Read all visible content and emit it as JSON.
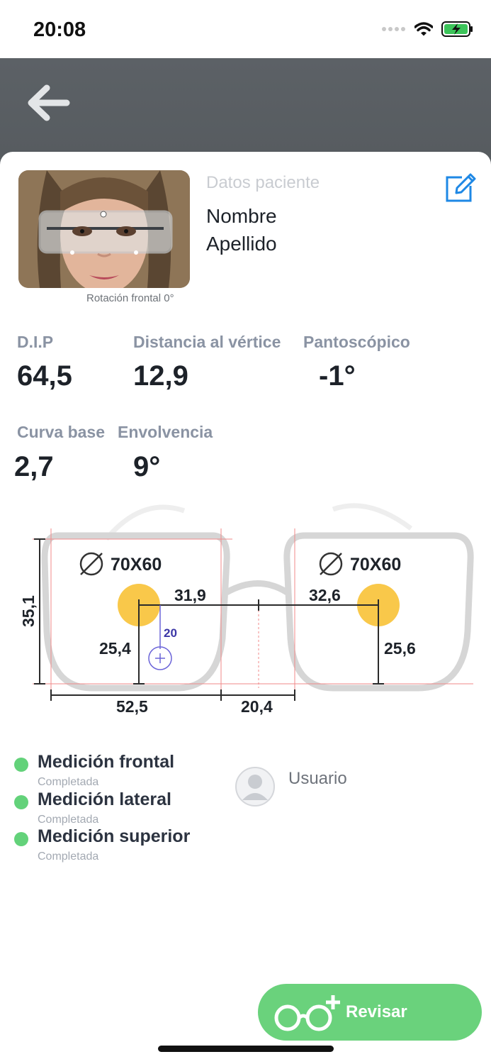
{
  "status_bar": {
    "time": "20:08"
  },
  "patient": {
    "section_title": "Datos paciente",
    "first_name": "Nombre",
    "last_name": "Apellido",
    "photo_caption": "Rotación frontal 0°"
  },
  "measurements": {
    "dip": {
      "label": "D.I.P",
      "value": "64,5"
    },
    "vertex": {
      "label": "Distancia al vértice",
      "value": "12,9"
    },
    "pantoscopic": {
      "label": "Pantoscópico",
      "value": "-1°"
    },
    "base_curve": {
      "label": "Curva base",
      "value": "2,7"
    },
    "wrap": {
      "label": "Envolvencia",
      "value": "9°"
    }
  },
  "diagram": {
    "left_size": "70X60",
    "right_size": "70X60",
    "frame_height": "35,1",
    "left_half_distance": "31,9",
    "right_half_distance": "32,6",
    "left_height": "25,4",
    "right_height": "25,6",
    "offset": "20",
    "lens_width": "52,5",
    "bridge_width": "20,4"
  },
  "steps": [
    {
      "title": "Medición frontal",
      "status": "Completada"
    },
    {
      "title": "Medición lateral",
      "status": "Completada"
    },
    {
      "title": "Medición superior",
      "status": "Completada"
    }
  ],
  "user": {
    "label": "Usuario"
  },
  "review_button": {
    "label": "Revisar"
  },
  "colors": {
    "accent_green": "#6ad27c",
    "edit_blue": "#1e88e5",
    "pupil_yellow": "#f9c84a"
  }
}
